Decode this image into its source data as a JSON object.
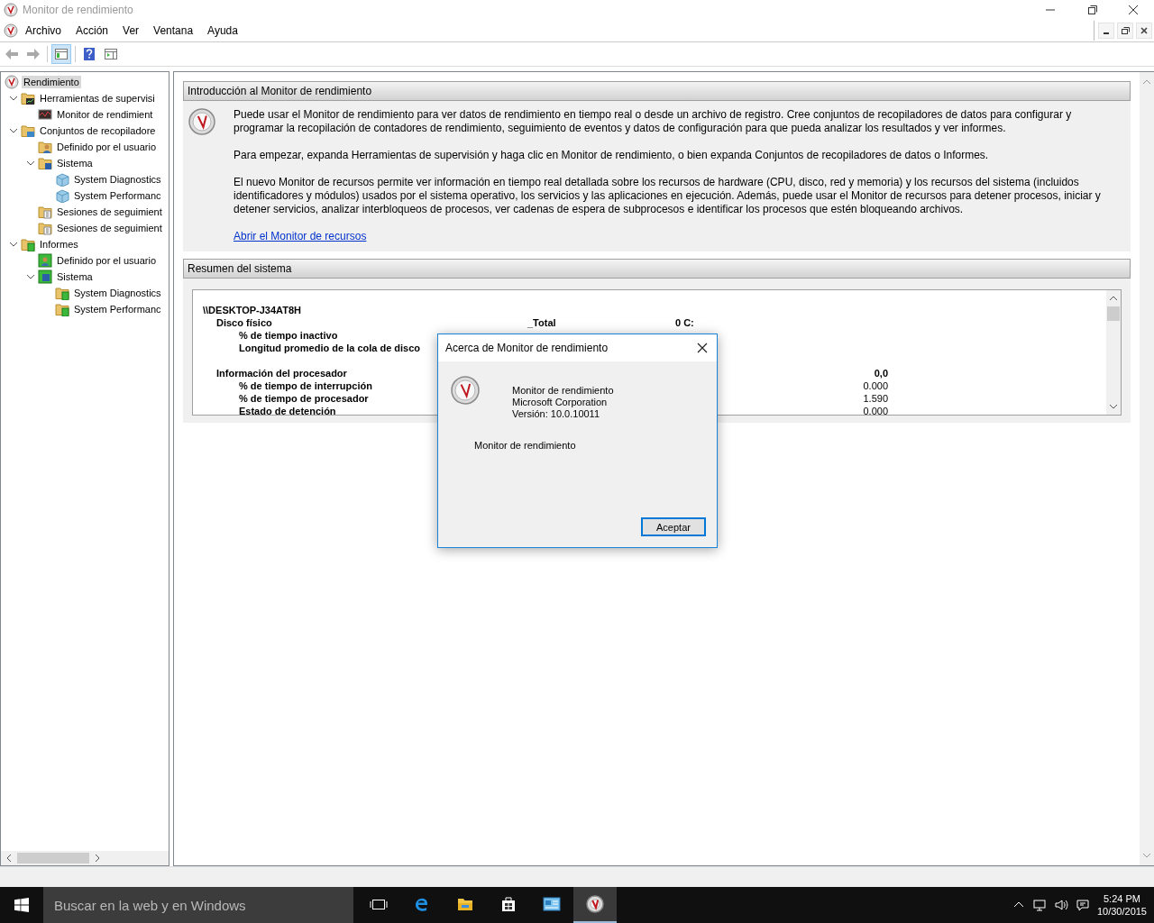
{
  "window": {
    "title": "Monitor de rendimiento",
    "active": false
  },
  "menu": [
    "Archivo",
    "Acción",
    "Ver",
    "Ventana",
    "Ayuda"
  ],
  "toolbar": [
    {
      "kind": "back",
      "pressed": false
    },
    {
      "kind": "forward",
      "pressed": false
    },
    {
      "kind": "tree-toggle",
      "pressed": true
    },
    {
      "kind": "help",
      "pressed": false
    },
    {
      "kind": "action-pane",
      "pressed": false
    }
  ],
  "tree": [
    {
      "label": "Rendimiento",
      "kind": "perf",
      "selected": true,
      "children": [
        {
          "label": "Herramientas de supervisi",
          "kind": "monitor-folder",
          "selected": false,
          "expanded": true,
          "children": [
            {
              "label": "Monitor de rendimient",
              "kind": "chart",
              "selected": false
            }
          ]
        },
        {
          "label": "Conjuntos de recopiladore",
          "kind": "collector-folder",
          "selected": false,
          "expanded": true,
          "children": [
            {
              "label": "Definido por el usuario",
              "kind": "user",
              "selected": false
            },
            {
              "label": "Sistema",
              "kind": "system",
              "selected": false,
              "expanded": true,
              "children": [
                {
                  "label": "System Diagnostics",
                  "kind": "set",
                  "selected": false
                },
                {
                  "label": "System Performanc",
                  "kind": "set",
                  "selected": false
                }
              ]
            },
            {
              "label": "Sesiones de seguimient",
              "kind": "trace",
              "selected": false
            },
            {
              "label": "Sesiones de seguimient",
              "kind": "trace",
              "selected": false
            }
          ]
        },
        {
          "label": "Informes",
          "kind": "report-folder",
          "selected": false,
          "expanded": true,
          "children": [
            {
              "label": "Definido por el usuario",
              "kind": "user-report",
              "selected": false
            },
            {
              "label": "Sistema",
              "kind": "system-report",
              "selected": false,
              "expanded": true,
              "children": [
                {
                  "label": "System Diagnostics",
                  "kind": "report",
                  "selected": false
                },
                {
                  "label": "System Performanc",
                  "kind": "report",
                  "selected": false
                }
              ]
            }
          ]
        }
      ]
    }
  ],
  "intro": {
    "title": "Introducción al Monitor de rendimiento",
    "paragraphs": [
      "Puede usar el Monitor de rendimiento para ver datos de rendimiento en tiempo real o desde un archivo de registro. Cree conjuntos de recopiladores de datos para configurar y programar la recopilación de contadores de rendimiento, seguimiento de eventos y datos de configuración para que pueda analizar los resultados y ver informes.",
      "Para empezar, expanda Herramientas de supervisión y haga clic en Monitor de rendimiento, o bien expanda Conjuntos de recopiladores de datos o Informes.",
      "El nuevo Monitor de recursos permite ver información en tiempo real detallada sobre los recursos de hardware (CPU, disco, red y memoria) y los recursos del sistema (incluidos identificadores y módulos) usados por el sistema operativo, los servicios y las aplicaciones en ejecución. Además, puede usar el Monitor de recursos para detener procesos, iniciar y detener servicios, analizar interbloqueos de procesos, ver cadenas de espera de subprocesos e identificar los procesos que estén bloqueando archivos."
    ],
    "link": "Abrir el Monitor de recursos"
  },
  "summary": {
    "title": "Resumen del sistema",
    "host": "\\\\DESKTOP-J34AT8H",
    "sections": [
      {
        "title": "Disco físico",
        "columns": [
          "_Total",
          "0 C:"
        ],
        "rows": [
          {
            "label": "% de tiempo inactivo",
            "values": []
          },
          {
            "label": "Longitud promedio de la cola de disco",
            "values": []
          }
        ]
      },
      {
        "title": "Información del procesador",
        "columns": [
          "0,0"
        ],
        "rows": [
          {
            "label": "% de tiempo de interrupción",
            "values": [
              "0.000"
            ]
          },
          {
            "label": "% de tiempo de procesador",
            "values": [
              "1.590"
            ]
          },
          {
            "label": "Estado de detención",
            "values": [
              "0.000"
            ]
          }
        ]
      }
    ]
  },
  "dialog": {
    "title": "Acerca de Monitor de rendimiento",
    "lines": [
      "Monitor de rendimiento",
      "Microsoft Corporation",
      "Versión: 10.0.10011"
    ],
    "description": "Monitor de rendimiento",
    "button": {
      "label": "Aceptar",
      "default": true
    }
  },
  "taskbar": {
    "search_placeholder": "Buscar en la web y en Windows",
    "apps": [
      {
        "kind": "task-view",
        "active": false
      },
      {
        "kind": "edge",
        "active": false
      },
      {
        "kind": "explorer",
        "active": false
      },
      {
        "kind": "store",
        "active": false
      },
      {
        "kind": "admin",
        "active": false
      },
      {
        "kind": "perf",
        "active": true
      }
    ],
    "time": "5:24 PM",
    "date": "10/30/2015"
  }
}
